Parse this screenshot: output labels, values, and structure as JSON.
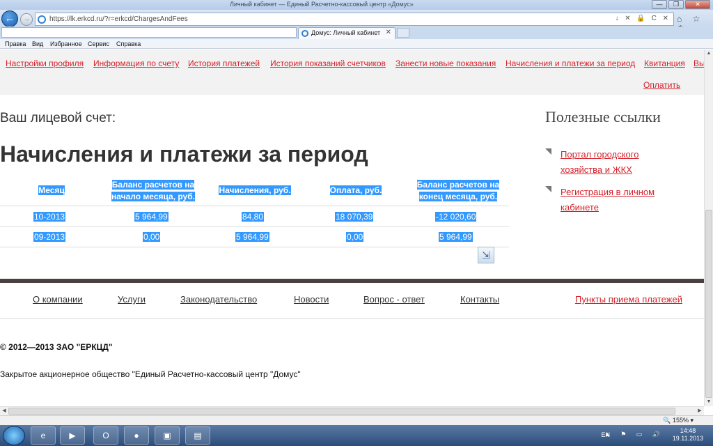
{
  "window": {
    "title": "Личный кабинет — Единый Расчетно-кассовый центр «Домус»",
    "controls": {
      "minimize": "—",
      "maximize": "❐",
      "close": "✕"
    }
  },
  "browser": {
    "url": "https://lk.erkcd.ru/?r=erkcd/ChargesAndFees",
    "url_icons": "↓ ✕ 🔒 C ✕",
    "tab_title": "Домус: Личный кабинет",
    "tab_close": "✕",
    "tool_icons": "⌂ ☆ ⚙",
    "menu": [
      "Правка",
      "Вид",
      "Избранное",
      "Сервис",
      "Справка"
    ],
    "zoom": "🔍 155% ▾"
  },
  "site": {
    "nav": [
      "Настройки профиля",
      "Информация по счету",
      "История платежей",
      "История показаний счетчиков",
      "Занести новые показания",
      "Начисления и платежи за период",
      "Квитанция",
      "Вы"
    ],
    "pay_link": "Оплатить",
    "account_label": "Ваш лицевой счет:",
    "page_title": "Начисления и платежи за период",
    "useful_title": "Полезные ссылки",
    "useful_links": [
      {
        "line1": "Портал городского",
        "line2": "хозяйства и ЖКХ"
      },
      {
        "line1": "Регистрация в личном",
        "line2": "кабинете"
      }
    ],
    "table": {
      "headers": [
        {
          "line1": "Месяц",
          "line2": ""
        },
        {
          "line1": "Баланс расчетов на",
          "line2": "начало месяца, руб."
        },
        {
          "line1": "Начисления, руб.",
          "line2": ""
        },
        {
          "line1": "Оплата, руб.",
          "line2": ""
        },
        {
          "line1": "Баланс расчетов на",
          "line2": "конец месяца, руб."
        }
      ],
      "rows": [
        [
          "10-2013",
          "5 964,99",
          "84,80",
          "18 070,39",
          "-12 020,60"
        ],
        [
          "09-2013",
          "0,00",
          "5 964,99",
          "0,00",
          "5 964,99"
        ]
      ]
    },
    "footer_nav": [
      "О компании",
      "Услуги",
      "Законодательство",
      "Новости",
      "Вопрос - ответ",
      "Контакты"
    ],
    "payment_points": "Пункты приема платежей",
    "copyright": "© 2012—2013 ЗАО \"ЕРКЦД\"",
    "company": "Закрытое акционерное общество \"Единый Расчетно-кассовый центр \"Домус\""
  },
  "taskbar": {
    "apps": [
      "e",
      "▶",
      "O",
      "●",
      "▣",
      "▤"
    ],
    "lang": "EN",
    "tray_icons": "▲ ⚑ ▭ 🔊",
    "time": "14:48",
    "date": "19.11.2013"
  }
}
